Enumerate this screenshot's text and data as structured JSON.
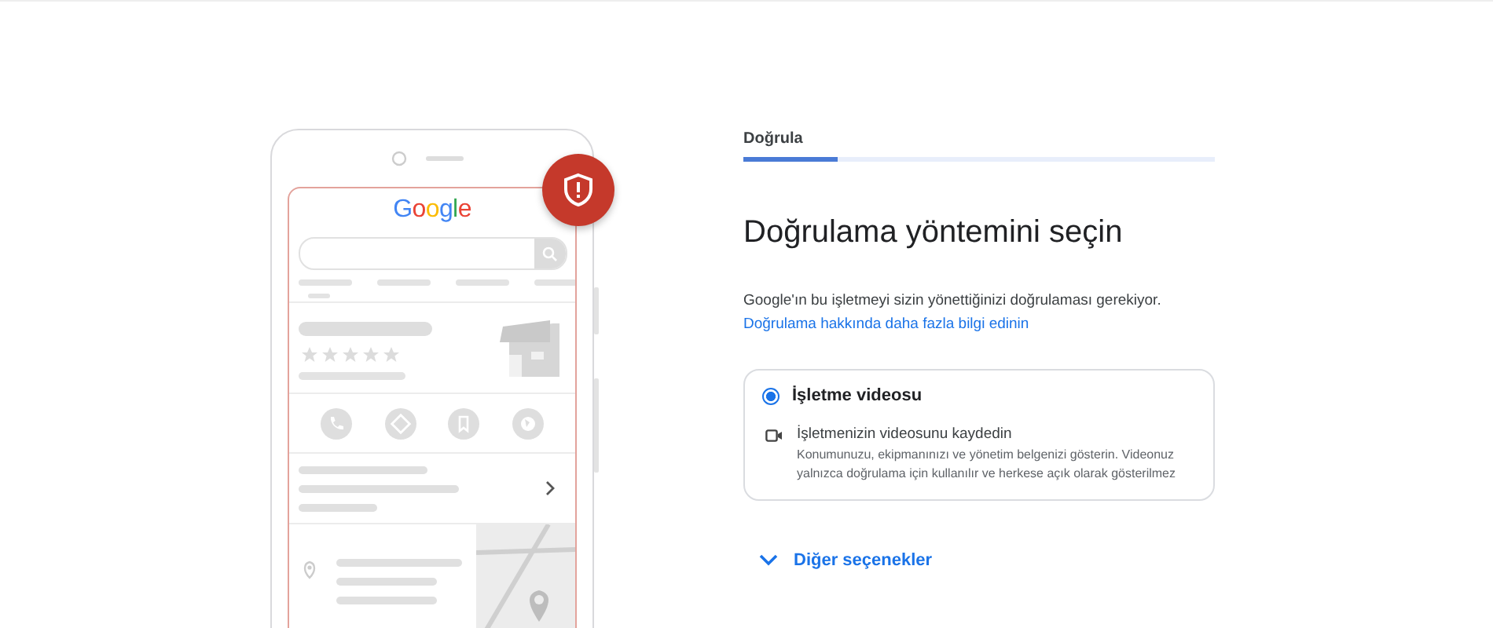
{
  "illustration": {
    "logo": "Google"
  },
  "stepper": {
    "label": "Doğrula",
    "level": 0.2
  },
  "heading": "Doğrulama yöntemini seçin",
  "description": "Google'ın bu işletmeyi sizin yönettiğinizi doğrulaması gerekiyor.",
  "link": "Doğrulama hakkında daha fazla bilgi edinin",
  "options": [
    {
      "title": "İşletme videosu",
      "selected": true,
      "method_title": "İşletmenizin videosunu kaydedin",
      "method_description": "Konumunuzu, ekipmanınızı ve yönetim belgenizi gösterin. Videonuz yalnızca doğrulama için kullanılır ve herkese açık olarak gösterilmez"
    }
  ],
  "more_options": {
    "label": "Diğer seçenekler",
    "expanded": false
  }
}
